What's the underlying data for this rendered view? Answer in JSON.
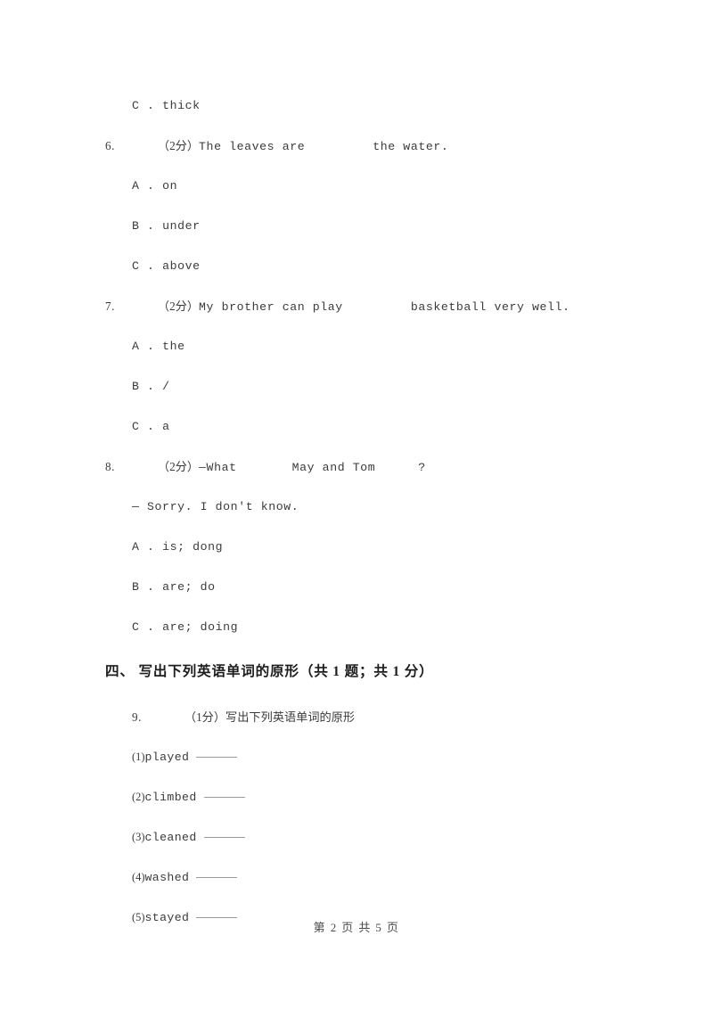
{
  "page": {
    "footer": "第 2 页 共 5 页",
    "text_color": "#3b3b3b",
    "heading_color": "#1d1d1d",
    "background": "#ffffff",
    "blank_rule_color": "#9a9a9a"
  },
  "orphan_option": {
    "letter": "C",
    "sep": " . ",
    "text": "thick"
  },
  "questions": [
    {
      "number": "6.",
      "marks": "（2分）",
      "stem_before": "The leaves are",
      "stem_after": "the water.",
      "options": [
        {
          "letter": "A",
          "sep": " . ",
          "text": "on"
        },
        {
          "letter": "B",
          "sep": " . ",
          "text": "under"
        },
        {
          "letter": "C",
          "sep": " . ",
          "text": "above"
        }
      ]
    },
    {
      "number": "7.",
      "marks": "（2分）",
      "stem_before": "My brother can play",
      "stem_after": "basketball very well.",
      "options": [
        {
          "letter": "A",
          "sep": " . ",
          "text": "the"
        },
        {
          "letter": "B",
          "sep": " . ",
          "text": "/"
        },
        {
          "letter": "C",
          "sep": " . ",
          "text": "a"
        }
      ]
    },
    {
      "number": "8.",
      "marks": "（2分）",
      "stem_part1": "—What",
      "stem_part2": "May and Tom",
      "stem_part3": "?",
      "stem_line2": "— Sorry. I don't know.",
      "options": [
        {
          "letter": "A",
          "sep": " . ",
          "text": "is; dong"
        },
        {
          "letter": "B",
          "sep": " . ",
          "text": "are; do"
        },
        {
          "letter": "C",
          "sep": " . ",
          "text": "are; doing"
        }
      ]
    }
  ],
  "section": {
    "heading": "四、 写出下列英语单词的原形（共 1 题；共 1 分）",
    "question": {
      "number": "9.",
      "marks": "（1分）",
      "title": "写出下列英语单词的原形",
      "items": [
        {
          "index": "(1)",
          "word": "played"
        },
        {
          "index": "(2)",
          "word": "climbed"
        },
        {
          "index": "(3)",
          "word": "cleaned"
        },
        {
          "index": "(4)",
          "word": "washed"
        },
        {
          "index": "(5)",
          "word": "stayed"
        }
      ]
    }
  }
}
